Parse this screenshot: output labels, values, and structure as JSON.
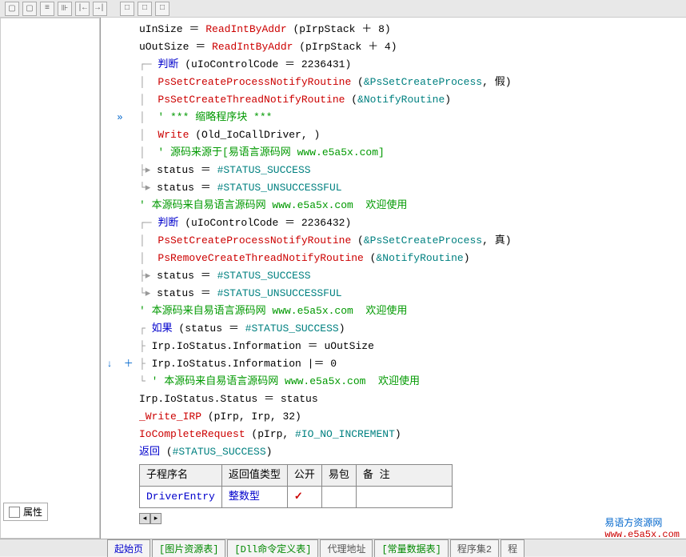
{
  "toolbar": {
    "icons": [
      "icon1",
      "icon2",
      "icon3",
      "icon4",
      "icon5",
      "icon6",
      "icon7",
      "icon8",
      "icon9",
      "icon10",
      "icon11"
    ]
  },
  "code": {
    "lines": [
      {
        "indent": 0,
        "prefix": "",
        "parts": [
          {
            "t": "uInSize ",
            "c": "black"
          },
          {
            "t": "＝ ",
            "c": "black"
          },
          {
            "t": "ReadIntByAddr",
            "c": "red"
          },
          {
            "t": " (pIrpStack ",
            "c": "black"
          },
          {
            "t": "＋ ",
            "c": "black"
          },
          {
            "t": "8",
            "c": "black"
          },
          {
            "t": ")",
            "c": "black"
          }
        ]
      },
      {
        "indent": 0,
        "prefix": "",
        "parts": [
          {
            "t": "uOutSize ",
            "c": "black"
          },
          {
            "t": "＝ ",
            "c": "black"
          },
          {
            "t": "ReadIntByAddr",
            "c": "red"
          },
          {
            "t": " (pIrpStack ",
            "c": "black"
          },
          {
            "t": "＋ ",
            "c": "black"
          },
          {
            "t": "4",
            "c": "black"
          },
          {
            "t": ")",
            "c": "black"
          }
        ]
      },
      {
        "indent": 0,
        "prefix": "┌─ ",
        "parts": [
          {
            "t": "判断",
            "c": "blue"
          },
          {
            "t": " (uIoControlCode ",
            "c": "black"
          },
          {
            "t": "＝ ",
            "c": "black"
          },
          {
            "t": "2236431",
            "c": "black"
          },
          {
            "t": ")",
            "c": "black"
          }
        ]
      },
      {
        "indent": 1,
        "prefix": "│  ",
        "parts": [
          {
            "t": "PsSetCreateProcessNotifyRoutine",
            "c": "red"
          },
          {
            "t": " (",
            "c": "black"
          },
          {
            "t": "&PsSetCreateProcess",
            "c": "teal"
          },
          {
            "t": ", ",
            "c": "black"
          },
          {
            "t": "假",
            "c": "black"
          },
          {
            "t": ")",
            "c": "black"
          }
        ]
      },
      {
        "indent": 1,
        "prefix": "│  ",
        "parts": [
          {
            "t": "PsSetCreateThreadNotifyRoutine",
            "c": "red"
          },
          {
            "t": " (",
            "c": "black"
          },
          {
            "t": "&NotifyRoutine",
            "c": "teal"
          },
          {
            "t": ")",
            "c": "black"
          }
        ]
      },
      {
        "indent": 1,
        "prefix": "│  ",
        "gutter": "»",
        "parts": [
          {
            "t": "' *** 缩略程序块 ***",
            "c": "green"
          }
        ]
      },
      {
        "indent": 1,
        "prefix": "│  ",
        "parts": [
          {
            "t": "Write",
            "c": "red"
          },
          {
            "t": " (Old_IoCallDriver, )",
            "c": "black"
          }
        ]
      },
      {
        "indent": 1,
        "prefix": "│  ",
        "parts": [
          {
            "t": "' 源码来源于[易语言源码网 www.e5a5x.com]",
            "c": "green"
          }
        ]
      },
      {
        "indent": 0,
        "prefix": "├▸ ",
        "parts": [
          {
            "t": "status ",
            "c": "black"
          },
          {
            "t": "＝ ",
            "c": "black"
          },
          {
            "t": "#STATUS_SUCCESS",
            "c": "teal"
          }
        ]
      },
      {
        "indent": 0,
        "prefix": "└▸ ",
        "parts": [
          {
            "t": "status ",
            "c": "black"
          },
          {
            "t": "＝ ",
            "c": "black"
          },
          {
            "t": "#STATUS_UNSUCCESSFUL",
            "c": "teal"
          }
        ]
      },
      {
        "indent": 0,
        "prefix": "",
        "parts": [
          {
            "t": "' 本源码来自易语言源码网 www.e5a5x.com  欢迎使用",
            "c": "green"
          }
        ]
      },
      {
        "indent": 0,
        "prefix": "┌─ ",
        "parts": [
          {
            "t": "判断",
            "c": "blue"
          },
          {
            "t": " (uIoControlCode ",
            "c": "black"
          },
          {
            "t": "＝ ",
            "c": "black"
          },
          {
            "t": "2236432",
            "c": "black"
          },
          {
            "t": ")",
            "c": "black"
          }
        ]
      },
      {
        "indent": 1,
        "prefix": "│  ",
        "parts": [
          {
            "t": "PsSetCreateProcessNotifyRoutine",
            "c": "red"
          },
          {
            "t": " (",
            "c": "black"
          },
          {
            "t": "&PsSetCreateProcess",
            "c": "teal"
          },
          {
            "t": ", ",
            "c": "black"
          },
          {
            "t": "真",
            "c": "black"
          },
          {
            "t": ")",
            "c": "black"
          }
        ]
      },
      {
        "indent": 1,
        "prefix": "│  ",
        "parts": [
          {
            "t": "PsRemoveCreateThreadNotifyRoutine",
            "c": "red"
          },
          {
            "t": " (",
            "c": "black"
          },
          {
            "t": "&NotifyRoutine",
            "c": "teal"
          },
          {
            "t": ")",
            "c": "black"
          }
        ]
      },
      {
        "indent": 0,
        "prefix": "├▸ ",
        "parts": [
          {
            "t": "status ",
            "c": "black"
          },
          {
            "t": "＝ ",
            "c": "black"
          },
          {
            "t": "#STATUS_SUCCESS",
            "c": "teal"
          }
        ]
      },
      {
        "indent": 0,
        "prefix": "└▸ ",
        "parts": [
          {
            "t": "status ",
            "c": "black"
          },
          {
            "t": "＝ ",
            "c": "black"
          },
          {
            "t": "#STATUS_UNSUCCESSFUL",
            "c": "teal"
          }
        ]
      },
      {
        "indent": 0,
        "prefix": "",
        "parts": [
          {
            "t": "' 本源码来自易语言源码网 www.e5a5x.com  欢迎使用",
            "c": "green"
          }
        ]
      },
      {
        "indent": 0,
        "prefix": "┌ ",
        "parts": [
          {
            "t": "如果",
            "c": "blue"
          },
          {
            "t": " (status ",
            "c": "black"
          },
          {
            "t": "＝ ",
            "c": "black"
          },
          {
            "t": "#STATUS_SUCCESS",
            "c": "teal"
          },
          {
            "t": ")",
            "c": "black"
          }
        ]
      },
      {
        "indent": 0,
        "prefix": "├ ",
        "parts": [
          {
            "t": "Irp.IoStatus.Information ",
            "c": "black"
          },
          {
            "t": "＝ ",
            "c": "black"
          },
          {
            "t": "uOutSize",
            "c": "black"
          }
        ]
      },
      {
        "indent": 0,
        "prefix": "├ ",
        "gutter": "↓  ＋",
        "parts": [
          {
            "t": "Irp.IoStatus.Information ",
            "c": "black"
          },
          {
            "t": "|＝ ",
            "c": "black"
          },
          {
            "t": "0",
            "c": "black"
          }
        ]
      },
      {
        "indent": 0,
        "prefix": "└ ",
        "parts": [
          {
            "t": "' 本源码来自易语言源码网 www.e5a5x.com  欢迎使用",
            "c": "green"
          }
        ]
      },
      {
        "indent": 0,
        "prefix": "",
        "parts": [
          {
            "t": "Irp.IoStatus.Status ",
            "c": "black"
          },
          {
            "t": "＝ ",
            "c": "black"
          },
          {
            "t": "status",
            "c": "black"
          }
        ]
      },
      {
        "indent": 0,
        "prefix": "",
        "parts": [
          {
            "t": "_Write_IRP",
            "c": "red"
          },
          {
            "t": " (pIrp, Irp, ",
            "c": "black"
          },
          {
            "t": "32",
            "c": "black"
          },
          {
            "t": ")",
            "c": "black"
          }
        ]
      },
      {
        "indent": 0,
        "prefix": "",
        "parts": [
          {
            "t": "IoCompleteRequest",
            "c": "red"
          },
          {
            "t": " (pIrp, ",
            "c": "black"
          },
          {
            "t": "#IO_NO_INCREMENT",
            "c": "teal"
          },
          {
            "t": ")",
            "c": "black"
          }
        ]
      },
      {
        "indent": 0,
        "prefix": "",
        "parts": [
          {
            "t": "返回",
            "c": "blue"
          },
          {
            "t": " (",
            "c": "black"
          },
          {
            "t": "#STATUS_SUCCESS",
            "c": "teal"
          },
          {
            "t": ")",
            "c": "black"
          }
        ]
      }
    ]
  },
  "table": {
    "headers": [
      "子程序名",
      "返回值类型",
      "公开",
      "易包",
      "备 注"
    ],
    "row": {
      "name": "DriverEntry",
      "return_type": "整数型",
      "public_check": "✓"
    }
  },
  "bottom": {
    "properties_label": "属性",
    "tabs": [
      {
        "label": "起始页",
        "color": "blue"
      },
      {
        "label": "[图片资源表]",
        "color": "green"
      },
      {
        "label": "[Dll命令定义表]",
        "color": "green"
      },
      {
        "label": "代理地址",
        "color": "black"
      },
      {
        "label": "[常量数据表]",
        "color": "green"
      },
      {
        "label": "程序集2",
        "color": "black"
      },
      {
        "label": "程",
        "color": "black"
      }
    ]
  },
  "watermark": {
    "text1": "易语方资源网",
    "text2": "www.e5a5x.com"
  }
}
